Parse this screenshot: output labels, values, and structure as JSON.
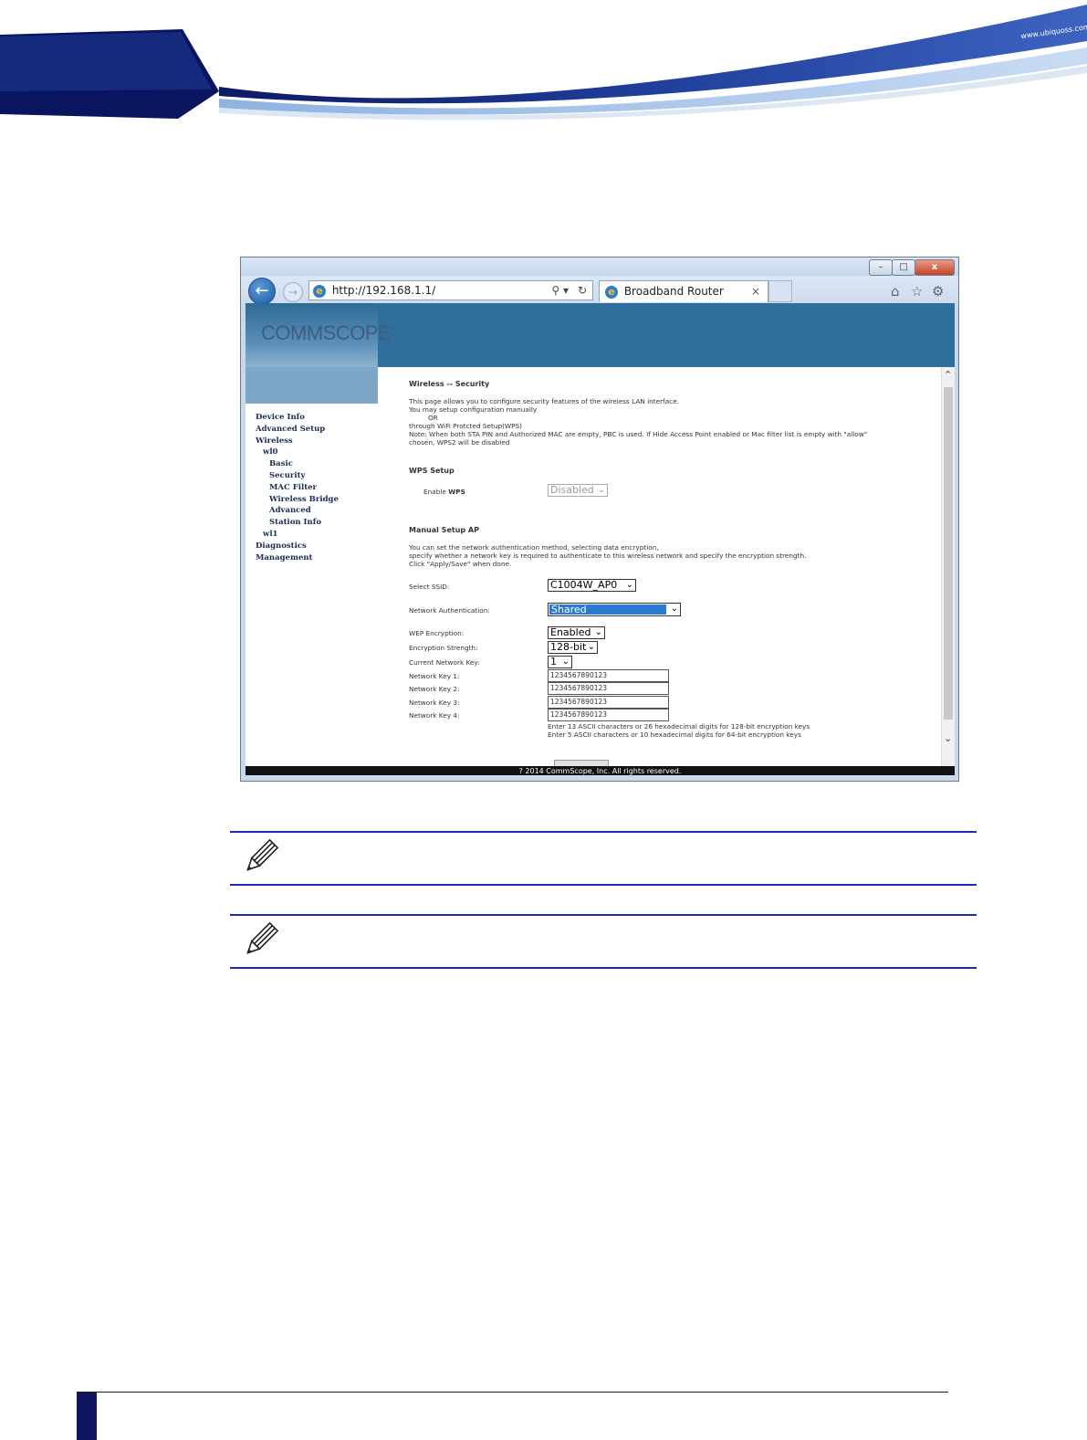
{
  "banner": {
    "site_url": "www.ubiquoss.com"
  },
  "browser": {
    "window_controls": [
      "–",
      "□",
      "x"
    ],
    "back_icon": "back-arrow-icon",
    "forward_icon": "forward-arrow-icon",
    "address_url": "http://192.168.1.1/",
    "search_icon_glyph": "⚲ ▾",
    "refresh_glyph": "↻",
    "tab_title": "Broadband Router",
    "tab_close": "×",
    "toolbar_icons": [
      "home-icon",
      "favorites-star-icon",
      "settings-gear-icon"
    ]
  },
  "router_page": {
    "logo_text": "COMMSCOPE",
    "logo_superscript": "®",
    "sidebar": {
      "device_info": "Device Info",
      "advanced_setup": "Advanced Setup",
      "wireless": "Wireless",
      "wl0": "wl0",
      "basic": "Basic",
      "security": "Security",
      "mac_filter": "MAC Filter",
      "wireless_bridge": "Wireless Bridge",
      "advanced": "Advanced",
      "station_info": "Station Info",
      "wl1": "wl1",
      "diagnostics": "Diagnostics",
      "management": "Management"
    },
    "title": "Wireless -- Security",
    "intro": [
      "This page allows you to configure security features of the wireless LAN interface.",
      "You may setup configuration manually",
      "OR",
      "through WiFi Protcted Setup(WPS)",
      "Note: When both STA PIN and Authorized MAC are empty, PBC is used. If Hide Access Point enabled or Mac filter list is empty with \"allow\"",
      "chosen, WPS2 will be disabled"
    ],
    "wps_setup": {
      "heading": "WPS Setup",
      "enable_label": "Enable ",
      "enable_label_bold": "WPS",
      "enable_value": "Disabled"
    },
    "manual_setup": {
      "heading": "Manual Setup AP",
      "desc": [
        "You can set the network authentication method, selecting data encryption,",
        "specify whether a network key is required to authenticate to this wireless network and specify the encryption strength.",
        "Click \"Apply/Save\" when done."
      ],
      "select_ssid_label": "Select SSID:",
      "select_ssid_value": "C1004W_AP0",
      "network_auth_label": "Network Authentication:",
      "network_auth_value": "Shared",
      "wep_label": "WEP Encryption:",
      "wep_value": "Enabled",
      "strength_label": "Encryption Strength:",
      "strength_value": "128-bit",
      "current_key_label": "Current Network Key:",
      "current_key_value": "1",
      "keys": [
        {
          "label": "Network Key 1:",
          "value": "1234567890123"
        },
        {
          "label": "Network Key 2:",
          "value": "1234567890123"
        },
        {
          "label": "Network Key 3:",
          "value": "1234567890123"
        },
        {
          "label": "Network Key 4:",
          "value": "1234567890123"
        }
      ],
      "hint_1": "Enter 13 ASCII characters or 26 hexadecimal digits for 128-bit encryption keys",
      "hint_2": "Enter 5 ASCII characters or 10 hexadecimal digits for 64-bit encryption keys"
    },
    "footer": "? 2014 CommScope, Inc. All rights reserved."
  },
  "notes": [
    {
      "icon": "pencil-note-icon"
    },
    {
      "icon": "pencil-note-icon"
    }
  ],
  "colors": {
    "accent_blue": "#1d2ab8",
    "page_tab": "#0f1560",
    "router_header": "#2e6f9e",
    "auth_select_bg": "#2a7ad2"
  }
}
